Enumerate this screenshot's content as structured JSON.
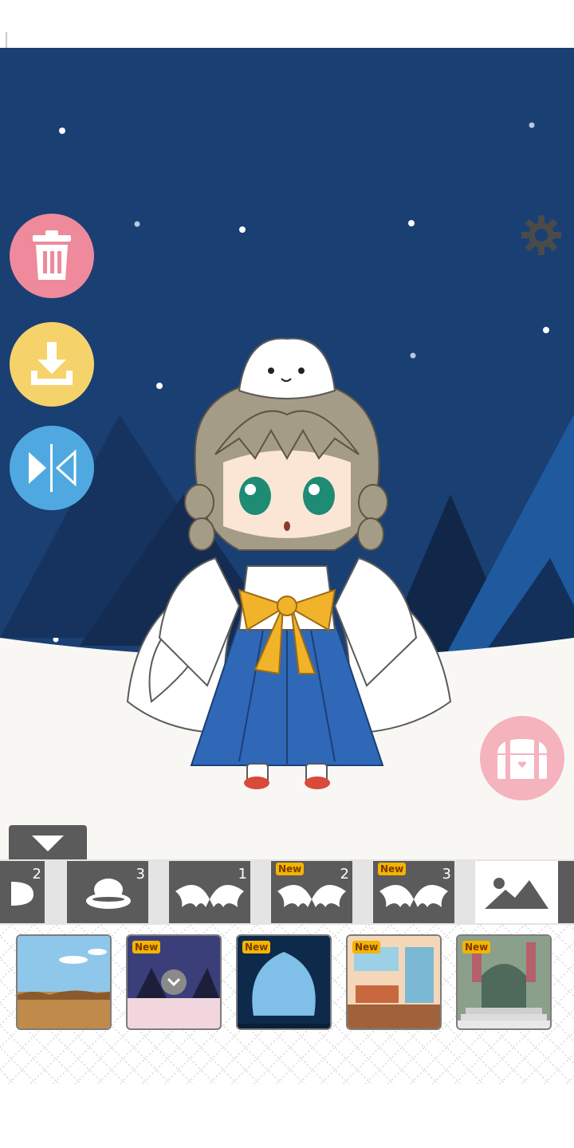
{
  "colors": {
    "sky": "#1a3f73",
    "snow": "#f8f7f4",
    "trash_button": "#ee8a9b",
    "save_button": "#f6d26b",
    "flip_button": "#4fa9e0",
    "chest_button": "#f4b3bd",
    "tab_bar": "#5b5b5b",
    "new_badge": "#f4b400"
  },
  "side_buttons": [
    {
      "name": "trash-icon"
    },
    {
      "name": "download-icon"
    },
    {
      "name": "mirror-flip-icon"
    }
  ],
  "settings_icon": "gear-icon",
  "chest_icon": "treasure-chest-icon",
  "collapse_icon": "chevron-down-icon",
  "category_tabs": [
    {
      "icon": "partial-item-icon",
      "count": "2"
    },
    {
      "icon": "hat-icon",
      "count": "3"
    },
    {
      "icon": "bat-wings-icon",
      "count": "1"
    },
    {
      "icon": "bat-wings-icon",
      "count": "2",
      "badge": "New"
    },
    {
      "icon": "bat-wings-icon",
      "count": "3",
      "badge": "New"
    },
    {
      "icon": "background-image-icon",
      "selected": true
    }
  ],
  "backgrounds": [
    {
      "name": "desert"
    },
    {
      "name": "snowy-night",
      "badge": "New",
      "selected": true
    },
    {
      "name": "cave",
      "badge": "New"
    },
    {
      "name": "cafe",
      "badge": "New"
    },
    {
      "name": "mansion-entrance",
      "badge": "New"
    }
  ]
}
